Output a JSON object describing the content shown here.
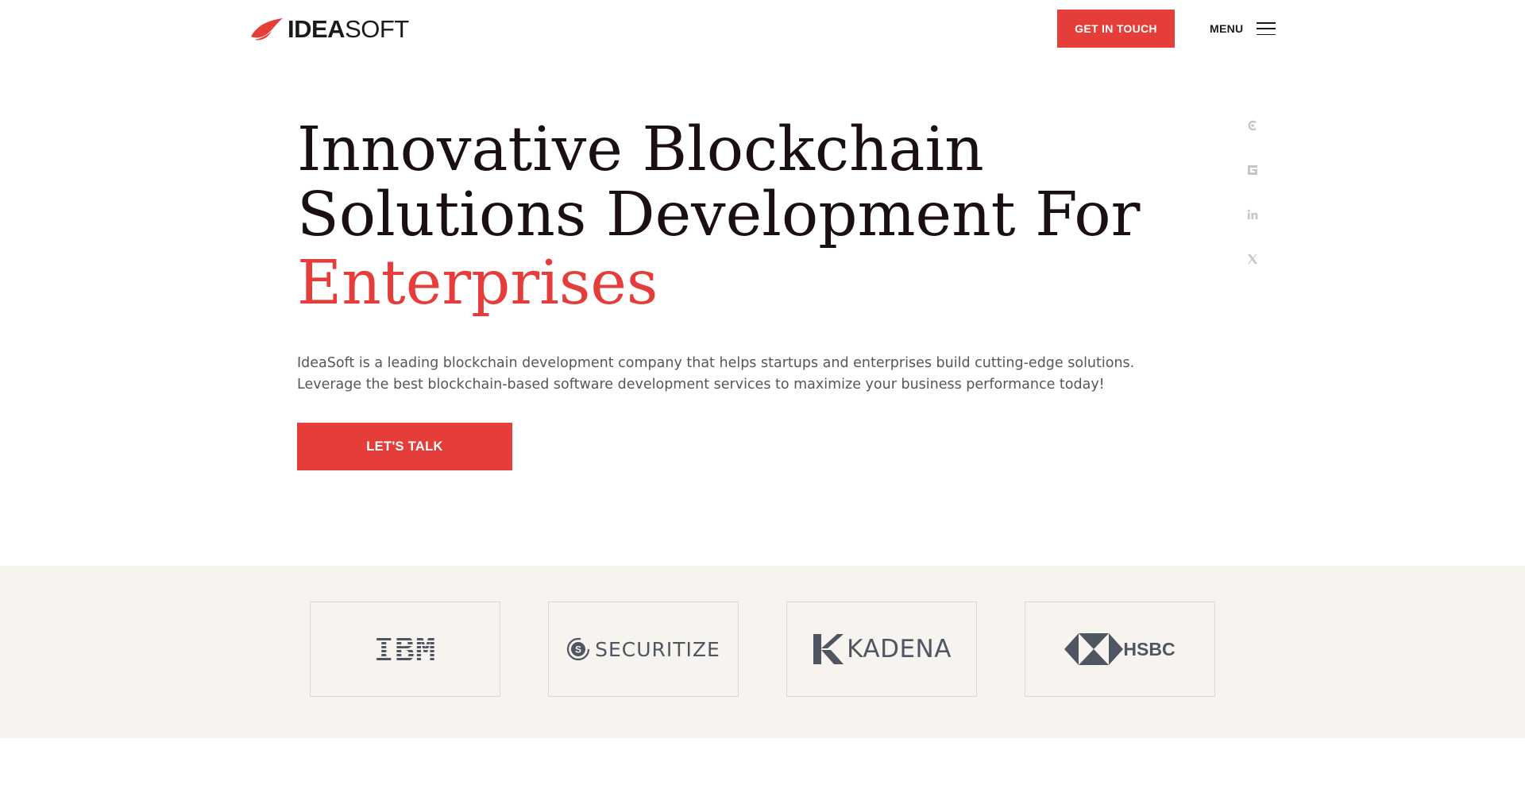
{
  "header": {
    "logo": {
      "bold": "IDEA",
      "light": "SOFT"
    },
    "cta_label": "GET IN TOUCH",
    "menu_label": "MENU"
  },
  "social": [
    "clutch-icon",
    "goodfirms-icon",
    "linkedin-icon",
    "x-icon"
  ],
  "hero": {
    "title_line1": "Innovative Blockchain",
    "title_line2": "Solutions Development For",
    "title_accent": "Enterprises",
    "description": "IdeaSoft is a leading blockchain development company that helps startups and enterprises build cutting-edge solutions. Leverage the best blockchain-based software development services to maximize your business performance today!",
    "button_label": "LET'S TALK"
  },
  "clients": [
    {
      "name": "IBM"
    },
    {
      "name": "SECURITIZE"
    },
    {
      "name": "KADENA"
    },
    {
      "name": "HSBC"
    }
  ],
  "colors": {
    "accent": "#e53e3a",
    "text": "#1a0f14",
    "band": "#f7f4ef",
    "logo_gray": "#4f5662"
  }
}
